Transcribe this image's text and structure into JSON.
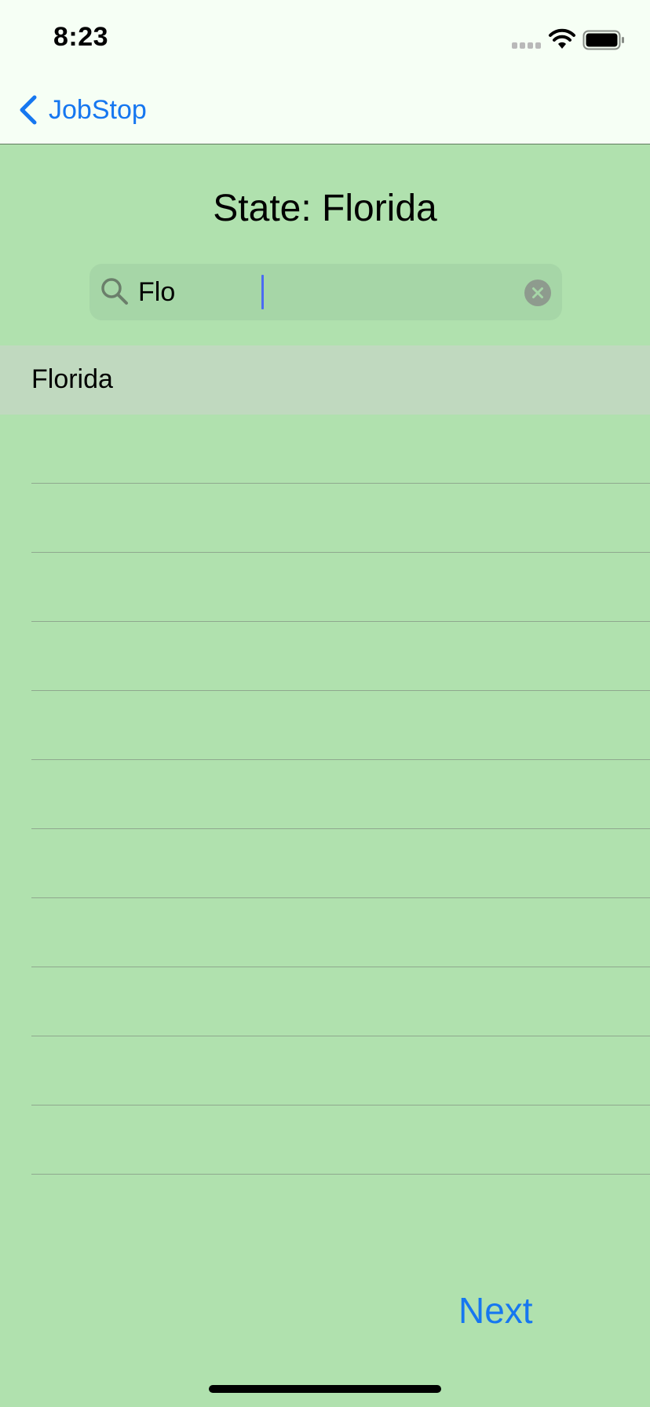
{
  "status_bar": {
    "time": "8:23"
  },
  "nav": {
    "back_label": "JobStop"
  },
  "page": {
    "title": "State: Florida"
  },
  "search": {
    "value": "Flo"
  },
  "results": [
    "Florida"
  ],
  "empty_rows": 12,
  "footer": {
    "next_label": "Next"
  },
  "colors": {
    "background": "#b0e1ae",
    "accent": "#1677f0",
    "selected_row": "#c0d9bf",
    "nav_bg": "#f6fff5"
  },
  "icons": [
    "chevron-left-icon",
    "search-icon",
    "clear-icon",
    "wifi-icon",
    "battery-icon",
    "signal-icon"
  ]
}
